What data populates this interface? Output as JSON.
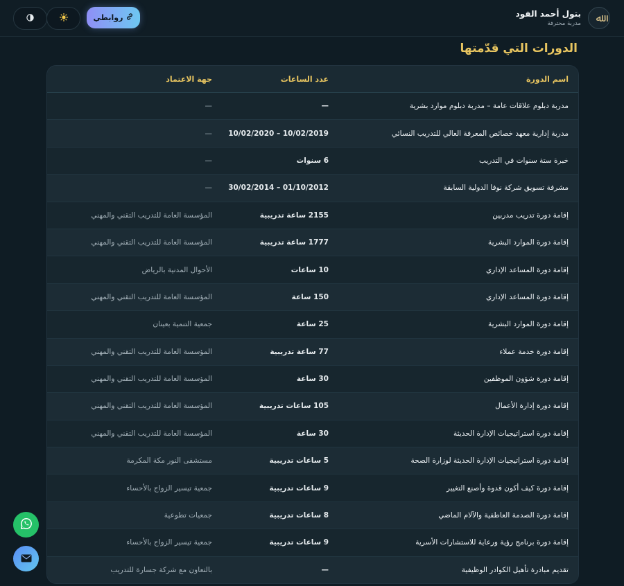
{
  "header": {
    "profile_name": "بتول أحمد الفود",
    "profile_role": "مدربة محترفة",
    "logo_glyph": "ﷲ",
    "links_label": "روابطي",
    "links_icon": "link-icon",
    "theme_light_icon": "sun-icon",
    "contrast_icon": "contrast-icon"
  },
  "section": {
    "title": "الدورات التي قدّمتها"
  },
  "table": {
    "headers": {
      "name": "اسم الدورة",
      "hours": "عدد الساعات",
      "entity": "جهة الاعتماد"
    },
    "rows": [
      {
        "name": "مدربة دبلوم علاقات عامة – مدربة دبلوم موارد بشرية",
        "hours": "—",
        "entity": "—"
      },
      {
        "name": "مدربة إدارية معهد خصائص المعرفة العالي للتدريب النسائي",
        "hours": "10/02/2019 – 10/02/2020",
        "entity": "—"
      },
      {
        "name": "خبرة ستة سنوات في التدريب",
        "hours": "6 سنوات",
        "entity": "—"
      },
      {
        "name": "مشرفة تسويق شركة نوفا الدولية السابقة",
        "hours": "01/10/2012 – 30/02/2014",
        "entity": "—"
      },
      {
        "name": "إقامة دورة تدريب مدربين",
        "hours": "2155 ساعة تدريبية",
        "entity": "المؤسسة العامة للتدريب التقني والمهني"
      },
      {
        "name": "إقامة دورة الموارد البشرية",
        "hours": "1777 ساعة تدريبية",
        "entity": "المؤسسة العامة للتدريب التقني والمهني"
      },
      {
        "name": "إقامة دورة المساعد الإداري",
        "hours": "10 ساعات",
        "entity": "الأحوال المدنية بالرياض"
      },
      {
        "name": "إقامة دورة المساعد الإداري",
        "hours": "150 ساعة",
        "entity": "المؤسسة العامة للتدريب التقني والمهني"
      },
      {
        "name": "إقامة دورة الموارد البشرية",
        "hours": "25 ساعة",
        "entity": "جمعية التنمية بعينان"
      },
      {
        "name": "إقامة دورة خدمة عملاء",
        "hours": "77 ساعة تدريبية",
        "entity": "المؤسسة العامة للتدريب التقني والمهني"
      },
      {
        "name": "إقامة دورة شؤون الموظفين",
        "hours": "30 ساعة",
        "entity": "المؤسسة العامة للتدريب التقني والمهني"
      },
      {
        "name": "إقامة دورة إدارة الأعمال",
        "hours": "105 ساعات تدريبية",
        "entity": "المؤسسة العامة للتدريب التقني والمهني"
      },
      {
        "name": "إقامة دورة استراتيجيات الإدارة الحديثة",
        "hours": "30 ساعة",
        "entity": "المؤسسة العامة للتدريب التقني والمهني"
      },
      {
        "name": "إقامة دورة استراتيجيات الإدارة الحديثة لوزارة الصحة",
        "hours": "5 ساعات تدريبية",
        "entity": "مستشفى النور مكة المكرمة"
      },
      {
        "name": "إقامة دورة كيف أكون قدوة وأصنع التغيير",
        "hours": "9 ساعات تدريبية",
        "entity": "جمعية تيسير الزواج بالأحساء"
      },
      {
        "name": "إقامة دورة الصدمة العاطفية والآلام الماضي",
        "hours": "8 ساعات تدريبية",
        "entity": "جمعيات تطوعية"
      },
      {
        "name": "إقامة دورة برنامج رؤية ورعاية للاستشارات الأسرية",
        "hours": "9 ساعات تدريبية",
        "entity": "جمعية تيسير الزواج بالأحساء"
      },
      {
        "name": "تقديم مبادرة تأهيل الكوادر الوظيفية",
        "hours": "—",
        "entity": "بالتعاون مع شركة جسارة للتدريب"
      }
    ]
  },
  "fabs": {
    "whatsapp_icon": "whatsapp-icon",
    "mail_icon": "mail-icon"
  },
  "colors": {
    "accent_gold": "#e8c560",
    "whatsapp_green": "#25c168",
    "background": "#0f1c24"
  }
}
